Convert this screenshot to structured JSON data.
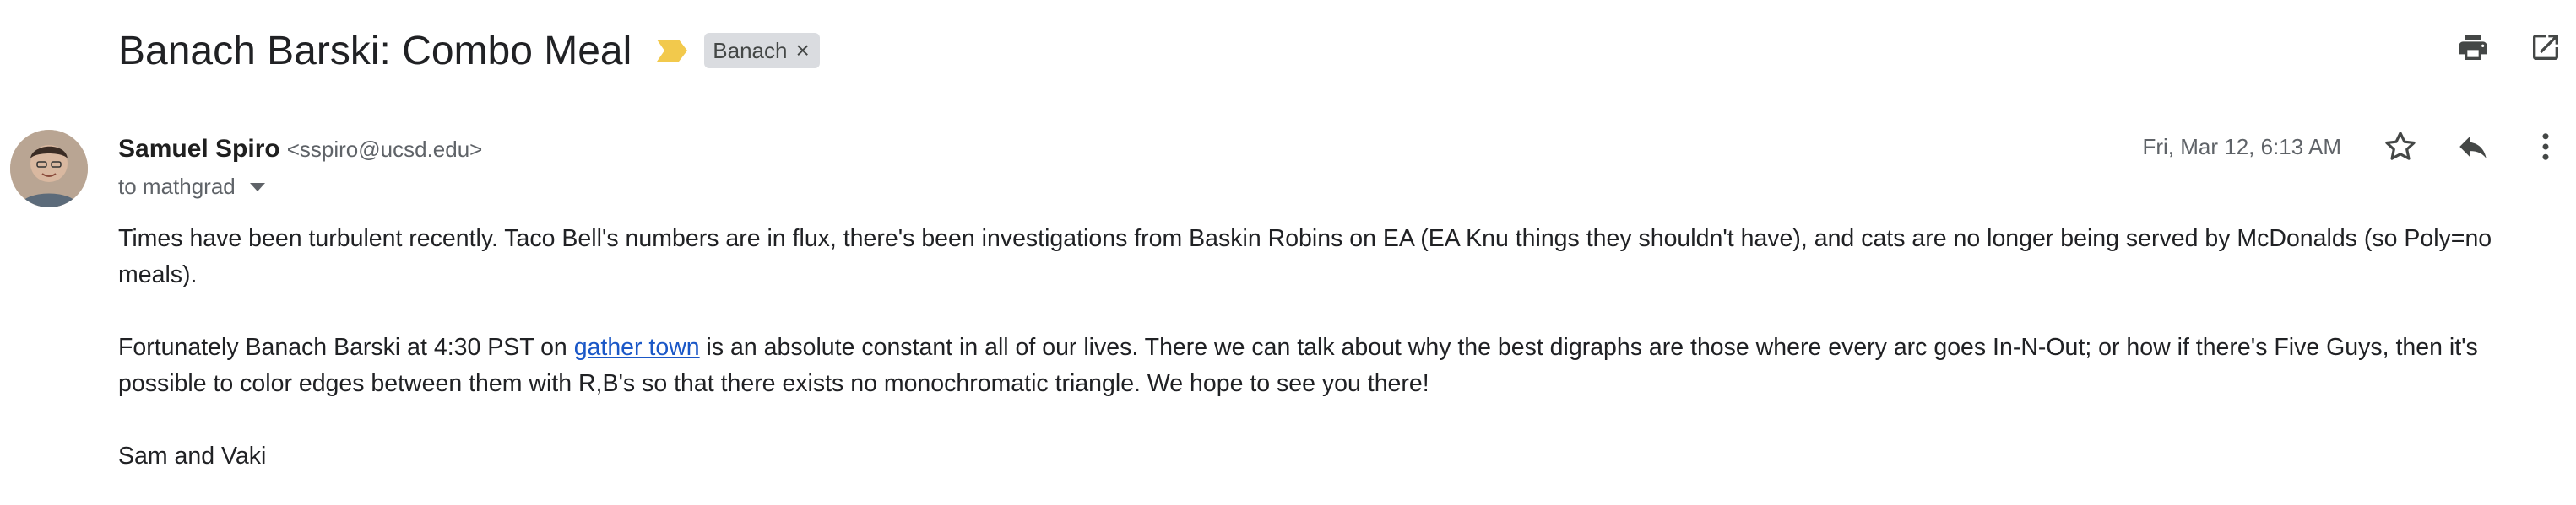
{
  "email": {
    "subject": "Banach Barski: Combo Meal",
    "label": "Banach",
    "sender_name": "Samuel Spiro",
    "sender_email": "<sspiro@ucsd.edu>",
    "to_text": "to mathgrad",
    "date": "Fri, Mar 12, 6:13 AM",
    "body": {
      "p1": "Times have been turbulent recently.  Taco Bell's numbers are in flux, there's been investigations from Baskin Robins on EA (EA Knu things they shouldn't have), and cats are no longer being served by McDonalds (so Poly=no meals).",
      "p2_before": "Fortunately Banach Barski at 4:30 PST on ",
      "p2_link": "gather town",
      "p2_after": " is an absolute constant in all of our lives.  There we can talk about why the best digraphs are those where every arc goes In-N-Out; or how if there's Five Guys, then it's possible to color edges between them with R,B's so that there exists no monochromatic triangle.  We hope to see you there!",
      "signature": "Sam and Vaki"
    }
  },
  "icons": {
    "importance": "importance-marker-icon",
    "label_remove": "close-icon",
    "print": "print-icon",
    "open_new_window": "open-in-new-icon",
    "expand_recipients": "chevron-down-icon",
    "star": "star-icon",
    "reply": "reply-icon",
    "more": "more-vert-icon"
  },
  "colors": {
    "importance": "#f2c94c",
    "link": "#1a57c7",
    "chip_bg": "#dadce0"
  }
}
